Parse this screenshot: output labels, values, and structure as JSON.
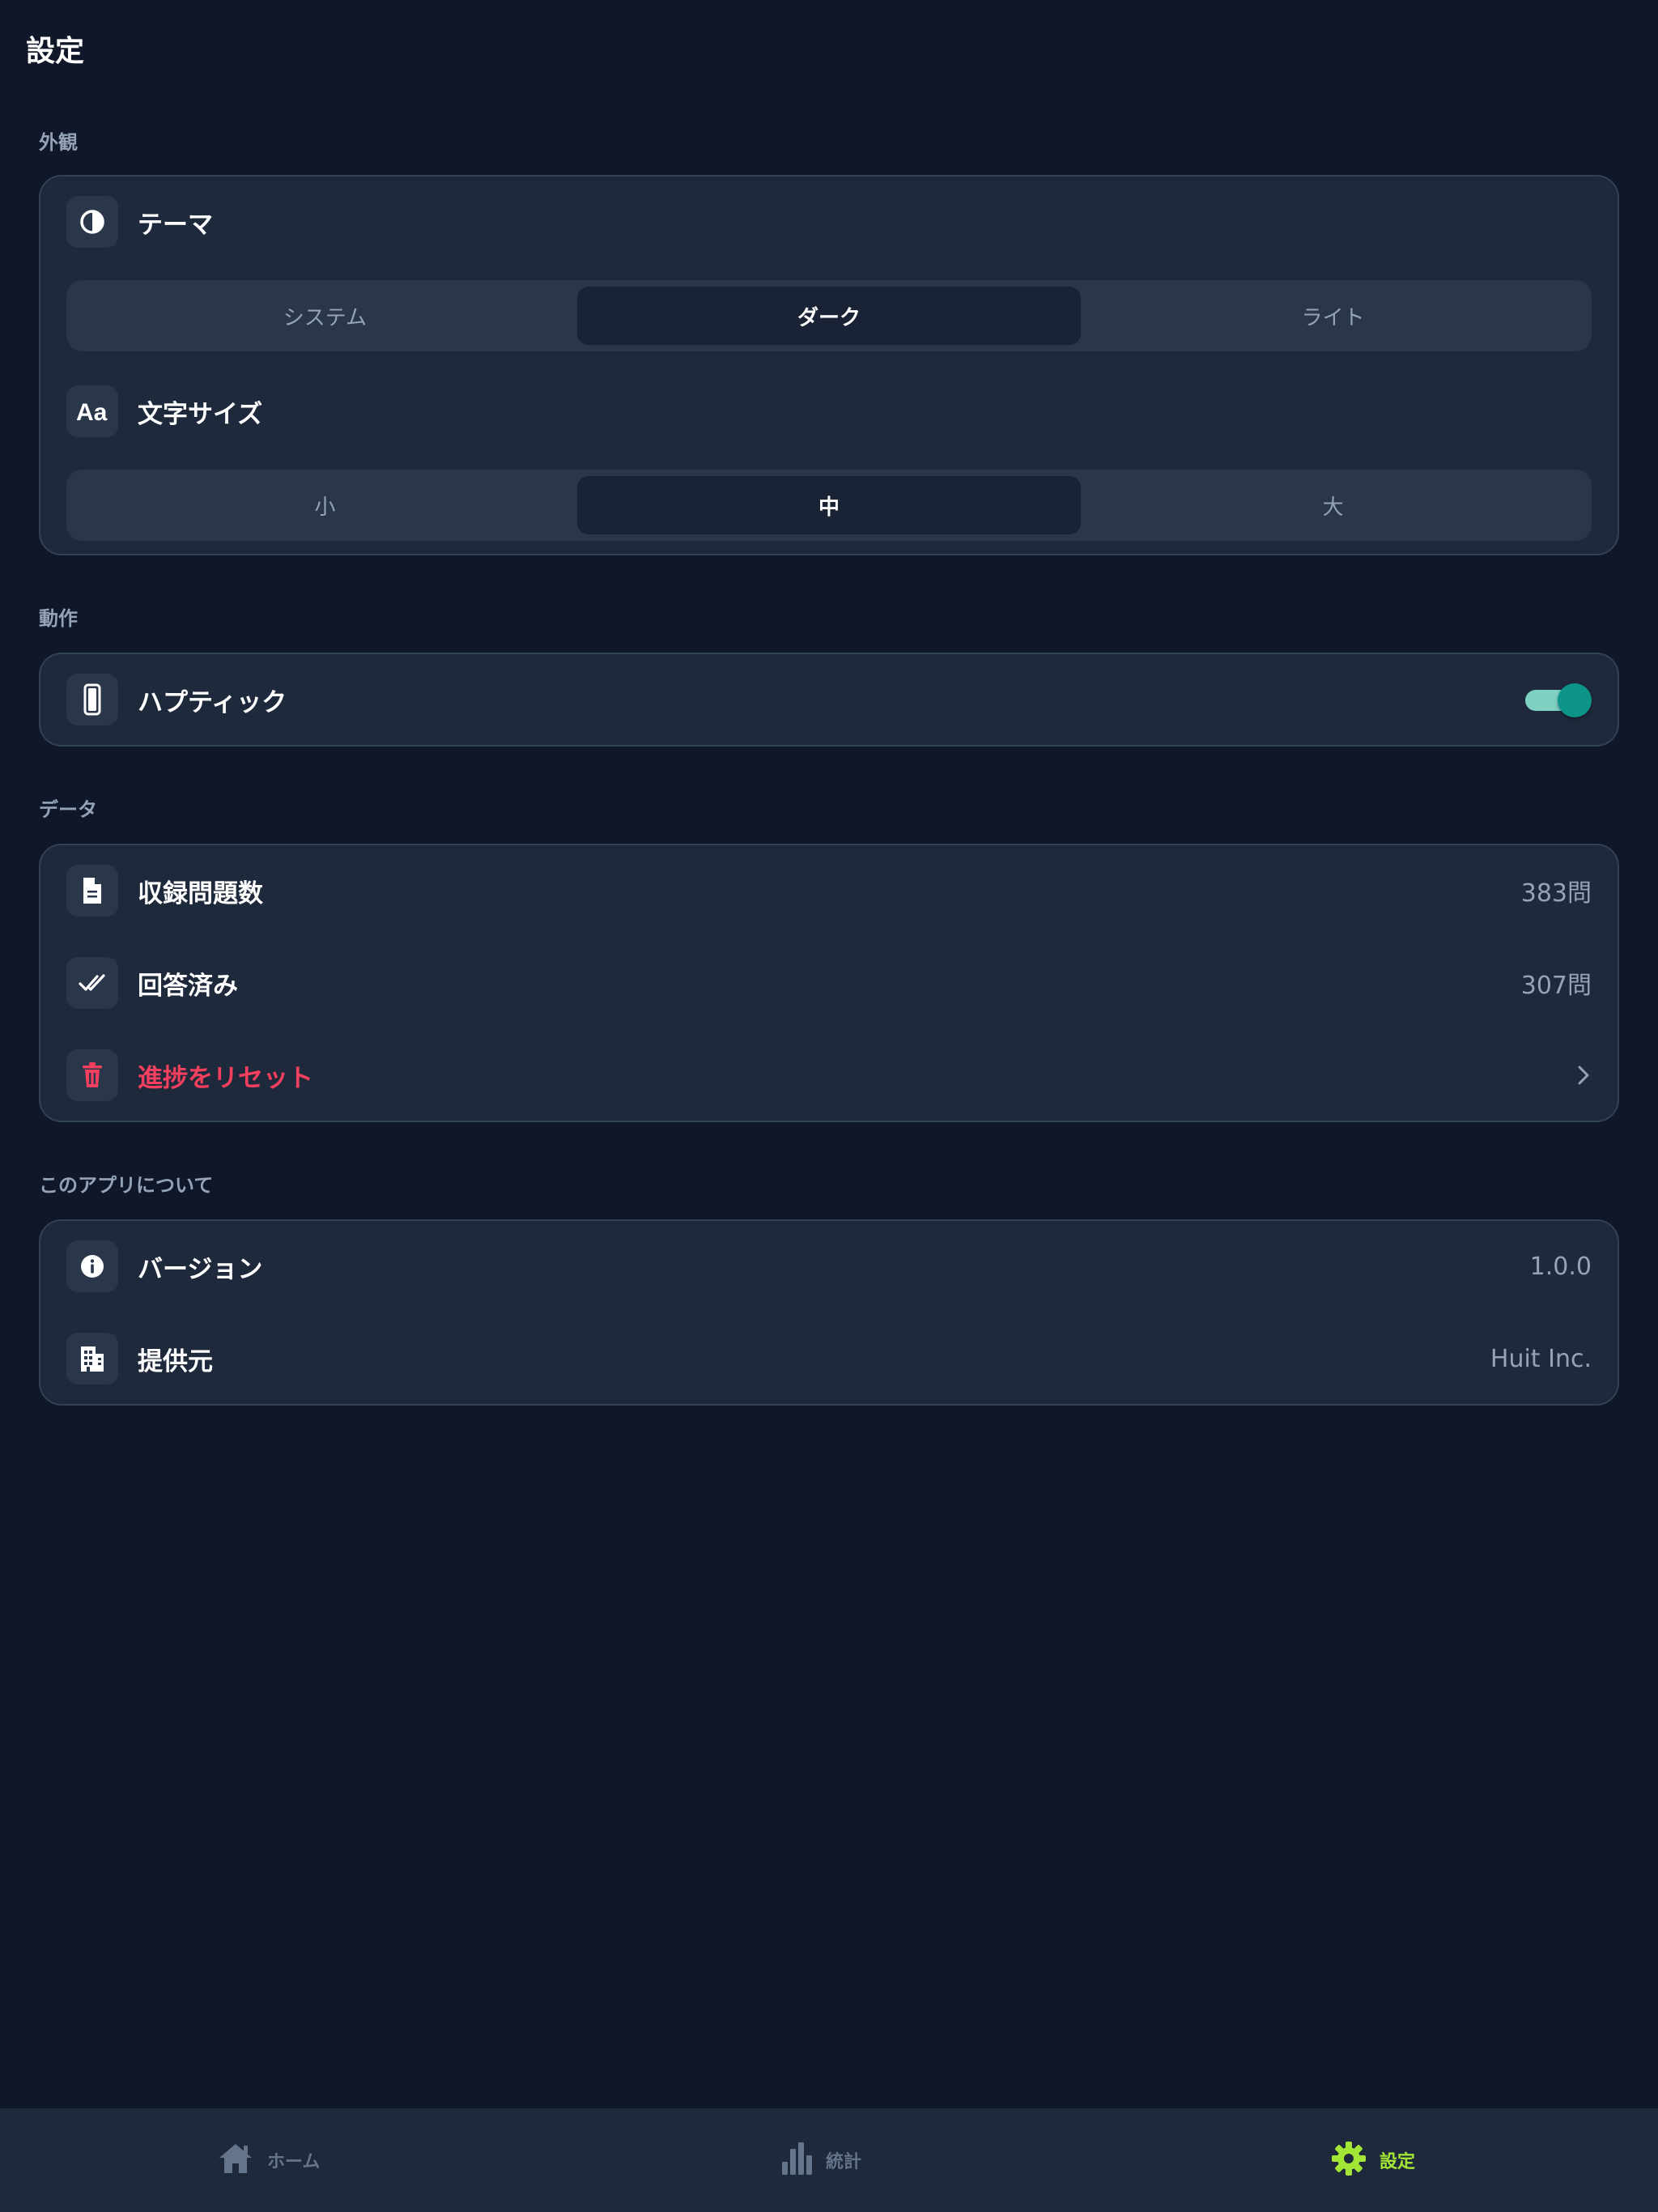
{
  "page_title": "設定",
  "sections": {
    "appearance": {
      "label": "外観",
      "theme": {
        "label": "テーマ",
        "icon": "contrast-icon",
        "options": [
          "システム",
          "ダーク",
          "ライト"
        ],
        "selected": "ダーク"
      },
      "font_size": {
        "label": "文字サイズ",
        "icon": "text-size-icon",
        "options": [
          "小",
          "中",
          "大"
        ],
        "selected": "中"
      }
    },
    "behavior": {
      "label": "動作",
      "haptic": {
        "label": "ハプティック",
        "icon": "phone-icon",
        "enabled": true
      }
    },
    "data": {
      "label": "データ",
      "total_questions": {
        "label": "収録問題数",
        "value": "383問",
        "icon": "document-icon"
      },
      "answered": {
        "label": "回答済み",
        "value": "307問",
        "icon": "double-check-icon"
      },
      "reset": {
        "label": "進捗をリセット",
        "icon": "trash-icon"
      }
    },
    "about": {
      "label": "このアプリについて",
      "version": {
        "label": "バージョン",
        "value": "1.0.0",
        "icon": "info-icon"
      },
      "provider": {
        "label": "提供元",
        "value": "Huit Inc.",
        "icon": "building-icon"
      }
    }
  },
  "tabbar": {
    "tabs": [
      {
        "label": "ホーム",
        "icon": "home-icon",
        "active": false
      },
      {
        "label": "統計",
        "icon": "chart-bars-icon",
        "active": false
      },
      {
        "label": "設定",
        "icon": "gear-icon",
        "active": true
      }
    ]
  },
  "colors": {
    "background": "#0f1729",
    "card": "#1e293b",
    "accent_active_tab": "#a3e635",
    "danger": "#f43f5e",
    "toggle_on": "#0d9488"
  }
}
